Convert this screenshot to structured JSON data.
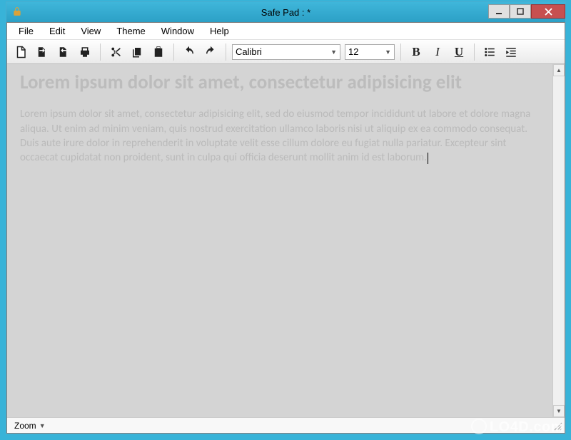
{
  "window": {
    "title": "Safe Pad : *"
  },
  "menu": {
    "file": "File",
    "edit": "Edit",
    "view": "View",
    "theme": "Theme",
    "window": "Window",
    "help": "Help"
  },
  "toolbar": {
    "font_name": "Calibri",
    "font_size": "12",
    "bold": "B",
    "italic": "I",
    "underline": "U"
  },
  "document": {
    "heading": "Lorem ipsum dolor sit amet, consectetur adipisicing elit",
    "body": "Lorem ipsum dolor sit amet, consectetur adipisicing elit, sed do eiusmod tempor incididunt ut labore et dolore magna aliqua. Ut enim ad minim veniam, quis nostrud exercitation ullamco laboris nisi ut aliquip ex ea commodo consequat. Duis aute irure dolor in reprehenderit in voluptate velit esse cillum dolore eu fugiat nulla pariatur. Excepteur sint occaecat cupidatat non proident, sunt in culpa qui officia deserunt mollit anim id est laborum."
  },
  "status": {
    "zoom_label": "Zoom"
  },
  "watermark": "LO4D.com"
}
